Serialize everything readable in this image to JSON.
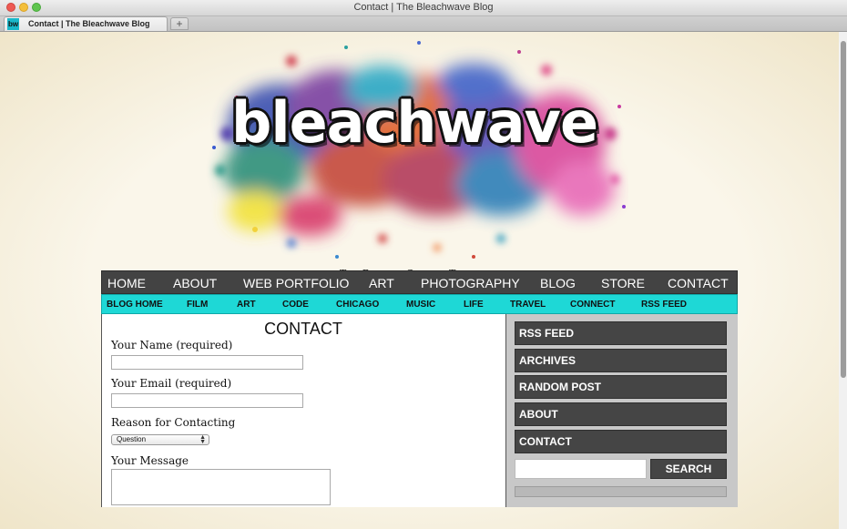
{
  "window": {
    "title": "Contact | The Bleachwave Blog",
    "tab_label": "Contact | The Bleachwave Blog",
    "favicon_text": "bw",
    "new_tab_label": "+"
  },
  "header": {
    "logo_text": "bleachwave",
    "tagline": "The Blog of Charlie Thomason"
  },
  "main_nav": {
    "items": [
      "HOME",
      "ABOUT",
      "WEB PORTFOLIO",
      "ART",
      "PHOTOGRAPHY",
      "BLOG",
      "STORE",
      "CONTACT"
    ]
  },
  "sub_nav": {
    "items": [
      "BLOG HOME",
      "FILM",
      "ART",
      "CODE",
      "CHICAGO",
      "MUSIC",
      "LIFE",
      "TRAVEL",
      "CONNECT",
      "RSS FEED"
    ]
  },
  "contact_form": {
    "title": "CONTACT",
    "name_label": "Your Name (required)",
    "name_value": "",
    "email_label": "Your Email (required)",
    "email_value": "",
    "reason_label": "Reason for Contacting",
    "reason_selected": "Question",
    "message_label": "Your Message",
    "message_value": ""
  },
  "sidebar": {
    "items": [
      "RSS FEED",
      "ARCHIVES",
      "RANDOM POST",
      "ABOUT",
      "CONTACT"
    ],
    "search_value": "",
    "search_button": "SEARCH"
  },
  "colors": {
    "nav_bg": "#434343",
    "subnav_bg": "#1ed8d6",
    "page_bg": "#faf6ea",
    "sidebar_bg": "#c8c8c8"
  }
}
